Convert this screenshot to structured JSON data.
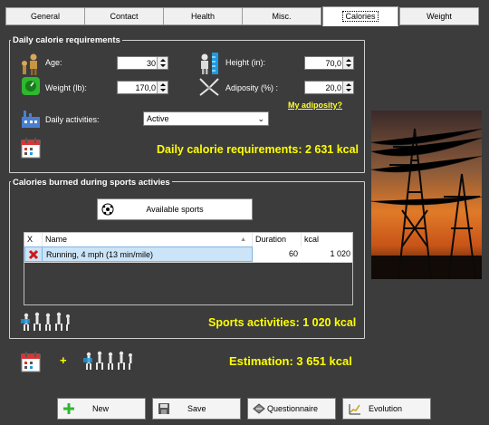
{
  "tabs": [
    {
      "label": "General",
      "active": false
    },
    {
      "label": "Contact",
      "active": false
    },
    {
      "label": "Health",
      "active": false
    },
    {
      "label": "Misc.",
      "active": false
    },
    {
      "label": "Calories",
      "active": true
    },
    {
      "label": "Weight",
      "active": false
    }
  ],
  "daily": {
    "title": "Daily calorie requirements",
    "age_label": "Age:",
    "age_value": "30",
    "height_label": "Height (in):",
    "height_value": "70,0",
    "weight_label": "Weight (lb):",
    "weight_value": "170,0",
    "adiposity_label": "Adiposity (%) :",
    "adiposity_value": "20,0",
    "my_adiposity_link": "My adiposity?",
    "activities_label": "Daily activities:",
    "activities_value": "Active",
    "result": "Daily calorie requirements: 2 631 kcal"
  },
  "sports": {
    "title": "Calories burned during sports activies",
    "available_button": "Available sports",
    "columns": [
      "X",
      "Name",
      "Duration",
      "kcal"
    ],
    "rows": [
      {
        "name": "Running, 4 mph (13 min/mile)",
        "duration": "60",
        "kcal": "1 020"
      }
    ],
    "result": "Sports activities: 1 020 kcal"
  },
  "estimation": {
    "plus": "+",
    "result": "Estimation: 3 651 kcal"
  },
  "buttons": {
    "new": "New",
    "save": "Save",
    "questionnaire": "Questionnaire",
    "evolution": "Evolution"
  },
  "colors": {
    "background": "#3c3c3c",
    "highlight": "#ffff00"
  },
  "icons": [
    "person-age-icon",
    "height-ruler-icon",
    "weight-scale-icon",
    "caliper-icon",
    "factory-icon",
    "calendar-icon",
    "soccer-ball-icon",
    "delete-x-icon",
    "sports-figures-icon",
    "plus-icon",
    "save-disk-icon",
    "questionnaire-icon",
    "evolution-icon",
    "power-lines-photo"
  ]
}
